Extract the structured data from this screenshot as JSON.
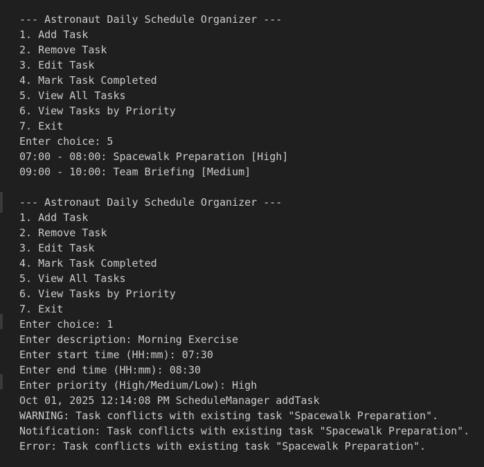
{
  "terminal": {
    "lines": [
      "--- Astronaut Daily Schedule Organizer ---",
      "1. Add Task",
      "2. Remove Task",
      "3. Edit Task",
      "4. Mark Task Completed",
      "5. View All Tasks",
      "6. View Tasks by Priority",
      "7. Exit",
      "Enter choice: 5",
      "07:00 - 08:00: Spacewalk Preparation [High]",
      "09:00 - 10:00: Team Briefing [Medium]",
      "",
      "--- Astronaut Daily Schedule Organizer ---",
      "1. Add Task",
      "2. Remove Task",
      "3. Edit Task",
      "4. Mark Task Completed",
      "5. View All Tasks",
      "6. View Tasks by Priority",
      "7. Exit",
      "Enter choice: 1",
      "Enter description: Morning Exercise",
      "Enter start time (HH:mm): 07:30",
      "Enter end time (HH:mm): 08:30",
      "Enter priority (High/Medium/Low): High",
      "Oct 01, 2025 12:14:08 PM ScheduleManager addTask",
      "WARNING: Task conflicts with existing task \"Spacewalk Preparation\".",
      "Notification: Task conflicts with existing task \"Spacewalk Preparation\".",
      "Error: Task conflicts with existing task \"Spacewalk Preparation\"."
    ]
  },
  "colors": {
    "background": "#1f1f1f",
    "text": "#cccccc",
    "gutter": "#3a3a3a"
  }
}
